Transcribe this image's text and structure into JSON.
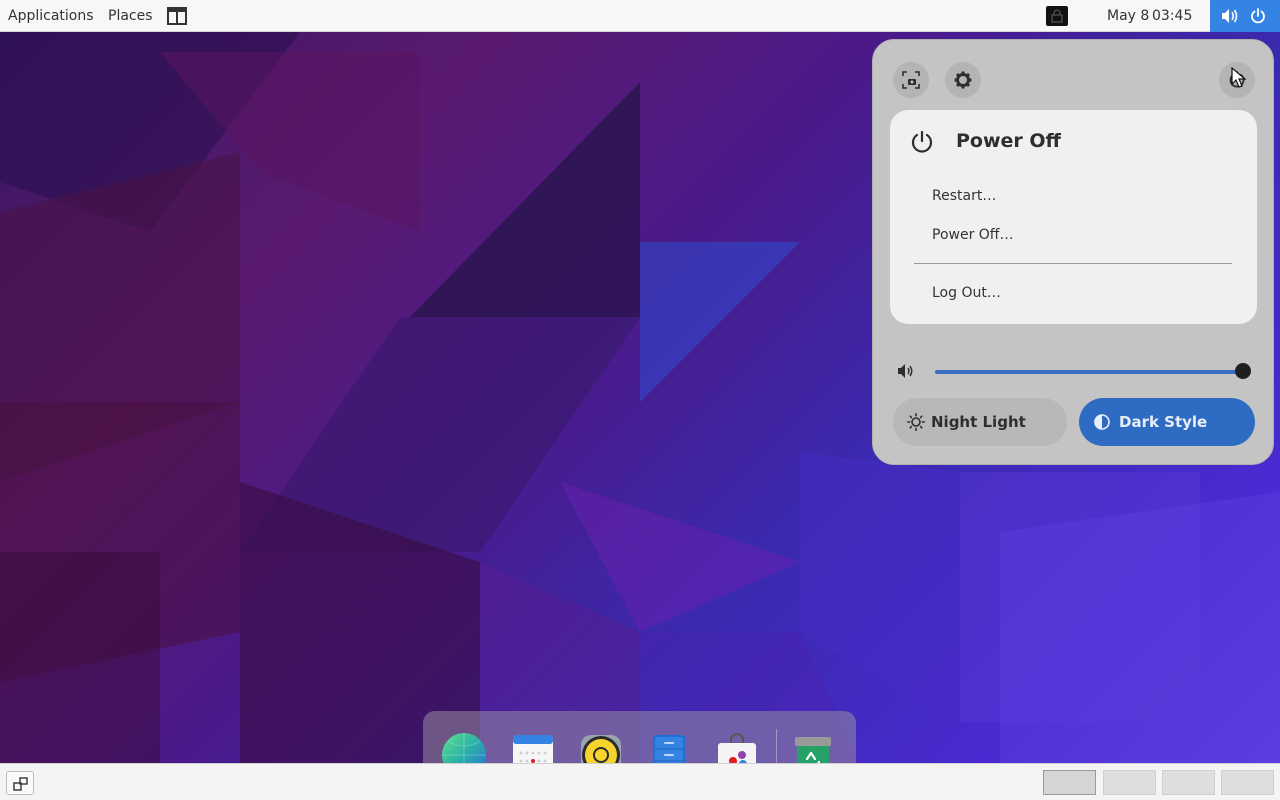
{
  "topbar": {
    "applications": "Applications",
    "places": "Places",
    "date": "May 8",
    "time": "03:45",
    "icons": [
      "window-layout-icon",
      "lock-indicator-icon",
      "volume-icon",
      "power-icon"
    ]
  },
  "quick_settings": {
    "top_buttons": [
      "screenshot-icon",
      "settings-gear-icon",
      "power-icon"
    ],
    "power_menu": {
      "title": "Power Off",
      "items": [
        "Restart…",
        "Power Off…",
        "Log Out…"
      ]
    },
    "volume": {
      "icon": "speaker-icon",
      "level": 1.0
    },
    "toggles": {
      "night_light": {
        "label": "Night Light",
        "icon": "sun-icon",
        "active": false
      },
      "dark_style": {
        "label": "Dark Style",
        "icon": "half-circle-icon",
        "active": true
      }
    }
  },
  "dock": {
    "apps": [
      "web-browser-icon",
      "calendar-icon",
      "music-player-icon",
      "file-manager-icon",
      "software-store-icon",
      "trash-icon"
    ]
  },
  "bottombar": {
    "workspaces": [
      {
        "active": true
      },
      {
        "active": false
      },
      {
        "active": false
      },
      {
        "active": false
      }
    ]
  },
  "colors": {
    "accent": "#3584e4",
    "dark_style_bg": "#2e6cc4",
    "panel_bg": "#c4c4c4",
    "menu_bg": "#f0f0f0"
  }
}
